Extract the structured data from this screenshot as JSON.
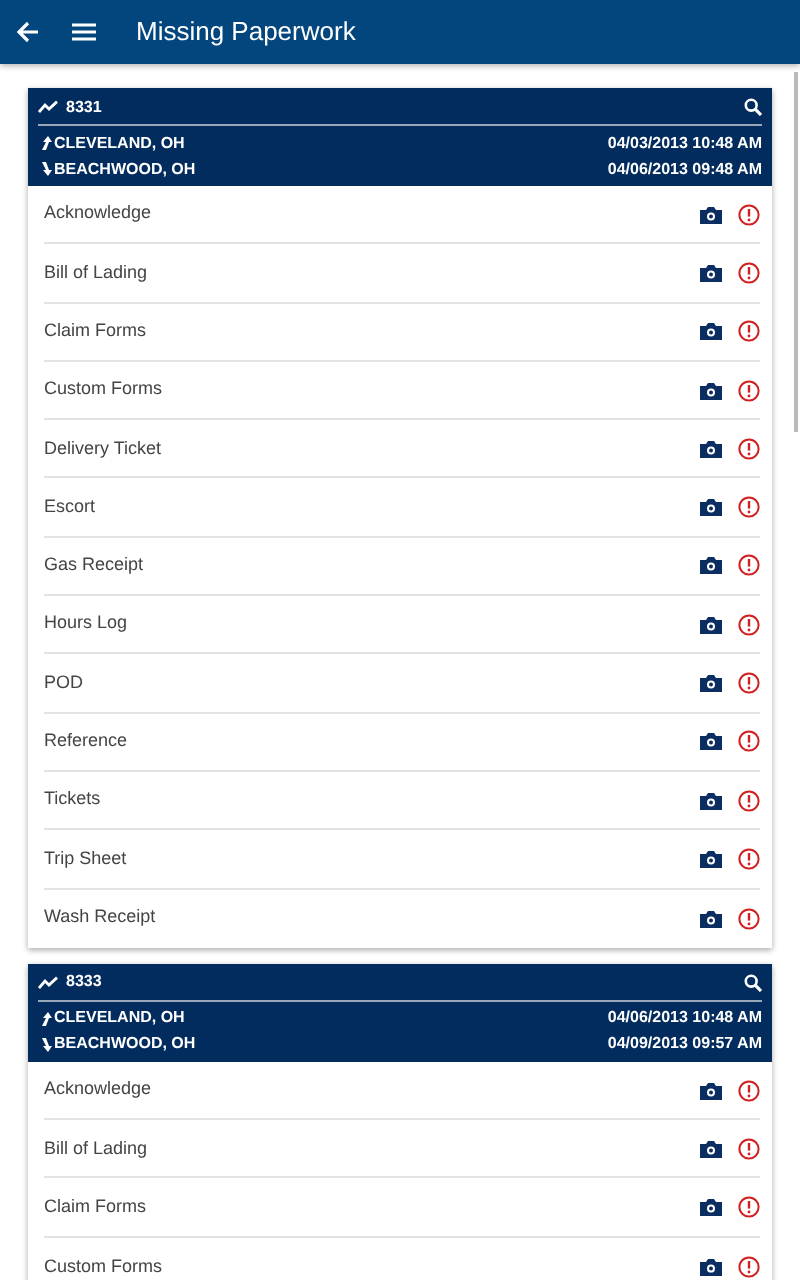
{
  "app_bar": {
    "title": "Missing Paperwork"
  },
  "loads": [
    {
      "number": "8331",
      "origin": "CLEVELAND, OH",
      "origin_time": "04/03/2013 10:48 AM",
      "destination": "BEACHWOOD, OH",
      "destination_time": "04/06/2013 09:48 AM",
      "documents": [
        "Acknowledge",
        "Bill of Lading",
        "Claim Forms",
        "Custom Forms",
        "Delivery Ticket",
        "Escort",
        "Gas Receipt",
        "Hours Log",
        "POD",
        "Reference",
        "Tickets",
        "Trip Sheet",
        "Wash Receipt"
      ]
    },
    {
      "number": "8333",
      "origin": "CLEVELAND, OH",
      "origin_time": "04/06/2013 10:48 AM",
      "destination": "BEACHWOOD, OH",
      "destination_time": "04/09/2013 09:57 AM",
      "documents": [
        "Acknowledge",
        "Bill of Lading",
        "Claim Forms",
        "Custom Forms"
      ]
    }
  ]
}
